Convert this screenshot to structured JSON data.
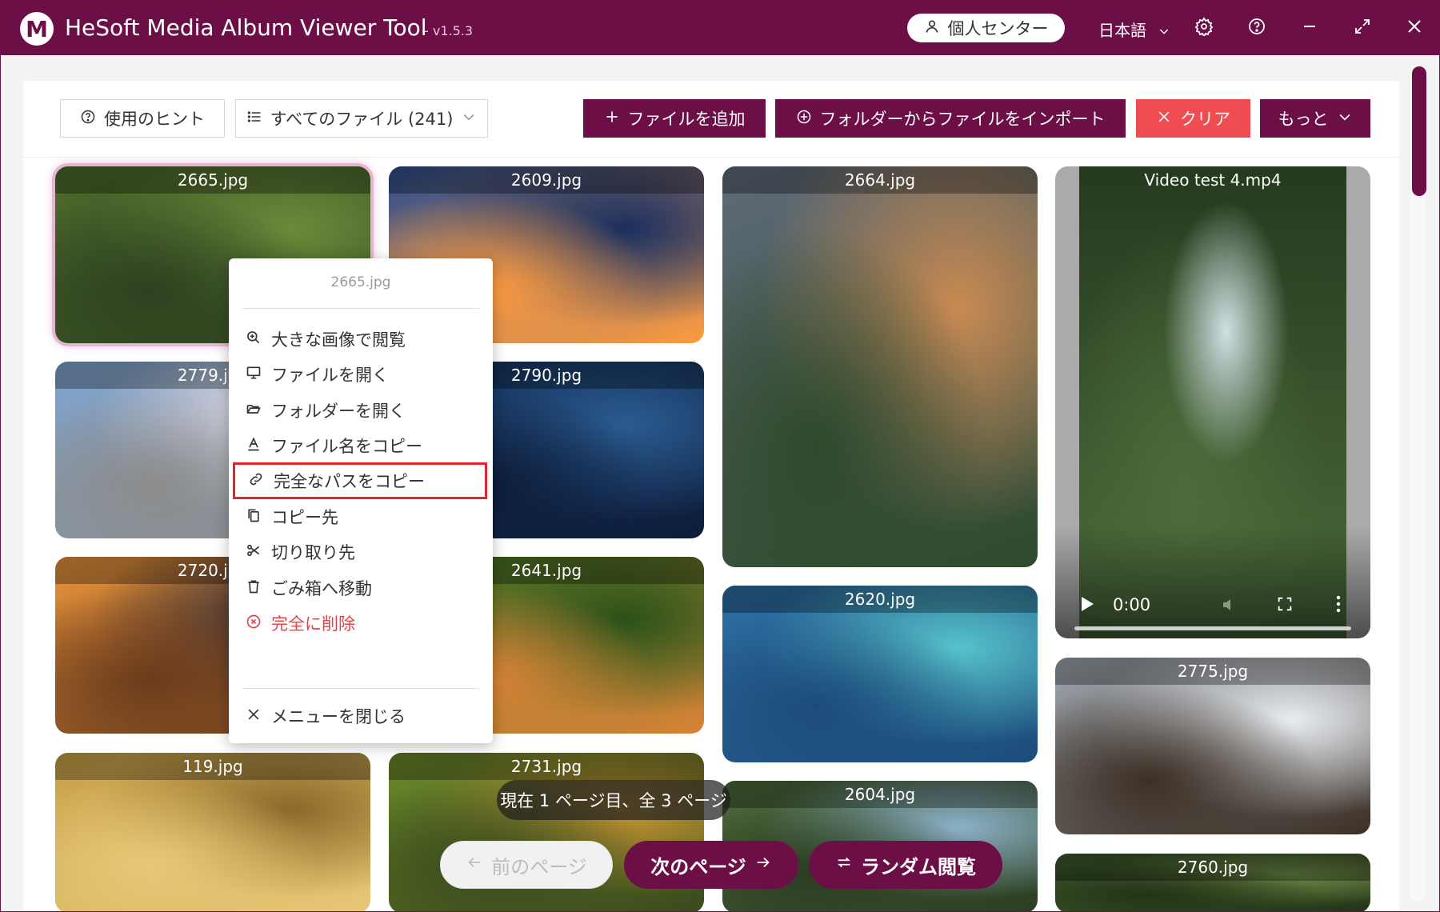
{
  "window": {
    "title": "HeSoft Media Album Viewer Tool",
    "version": "- v1.5.3",
    "logo_letter": "M",
    "user_center": "個人センター",
    "language": "日本語",
    "accent_color": "#6d0f47"
  },
  "toolbar": {
    "hints": "使用のヒント",
    "all_files": "すべてのファイル (241)",
    "add_file": "ファイルを追加",
    "import_folder": "フォルダーからファイルをインポート",
    "clear": "クリア",
    "more": "もっと"
  },
  "gallery": {
    "items": [
      {
        "name": "2665.jpg",
        "colors": [
          "#4e6b2c",
          "#6c8a3a",
          "#2e4220"
        ]
      },
      {
        "name": "2609.jpg",
        "colors": [
          "#2c4d8c",
          "#1b2f5e",
          "#ff9c3f"
        ]
      },
      {
        "name": "2664.jpg",
        "colors": [
          "#5f6b7a",
          "#c98a52",
          "#2f4a2c"
        ]
      },
      {
        "name": "2779.jpg",
        "colors": [
          "#7fa5d1",
          "#f0e7ef",
          "#8c8c8c"
        ]
      },
      {
        "name": "2790.jpg",
        "colors": [
          "#15345f",
          "#2a5b91",
          "#0e1e3b"
        ]
      },
      {
        "name": "2620.jpg",
        "colors": [
          "#2e6fa3",
          "#56c2c9",
          "#1c4c7a"
        ]
      },
      {
        "name": "2720.jpg",
        "colors": [
          "#e8943c",
          "#2e2b3b",
          "#6a3b1b"
        ]
      },
      {
        "name": "2641.jpg",
        "colors": [
          "#3d7a26",
          "#2a5219",
          "#d98236"
        ]
      },
      {
        "name": "2775.jpg",
        "colors": [
          "#9fa7b0",
          "#e8ecf0",
          "#3c3026"
        ]
      },
      {
        "name": "119.jpg",
        "colors": [
          "#c8a047",
          "#8b6a2a",
          "#e6c877"
        ]
      },
      {
        "name": "2731.jpg",
        "colors": [
          "#6c8a2a",
          "#c79232",
          "#3a4a1d"
        ]
      },
      {
        "name": "2604.jpg",
        "colors": [
          "#4d6a3a",
          "#8bb0c8",
          "#2c3d22"
        ]
      },
      {
        "name": "2760.jpg",
        "colors": [
          "#3f5a2b",
          "#6f8b48",
          "#243517"
        ]
      }
    ],
    "video": {
      "name": "Video test 4.mp4",
      "time": "0:00",
      "colors": [
        "#253a1e",
        "#4c6b3b",
        "#cfe0e4"
      ]
    }
  },
  "context_menu": {
    "header": "2665.jpg",
    "items": [
      {
        "label": "大きな画像で閲覧",
        "icon": "zoom-in-icon"
      },
      {
        "label": "ファイルを開く",
        "icon": "monitor-icon"
      },
      {
        "label": "フォルダーを開く",
        "icon": "folder-open-icon"
      },
      {
        "label": "ファイル名をコピー",
        "icon": "text-format-icon"
      },
      {
        "label": "完全なパスをコピー",
        "icon": "link-icon"
      },
      {
        "label": "コピー先",
        "icon": "copy-icon"
      },
      {
        "label": "切り取り先",
        "icon": "scissors-icon"
      },
      {
        "label": "ごみ箱へ移動",
        "icon": "trash-icon"
      },
      {
        "label": "完全に削除",
        "icon": "delete-circle-icon"
      }
    ],
    "close": "メニューを閉じる"
  },
  "pagination": {
    "info": "現在 1 ページ目、全 3 ページ",
    "prev": "前のページ",
    "next": "次のページ",
    "random": "ランダム閲覧"
  }
}
